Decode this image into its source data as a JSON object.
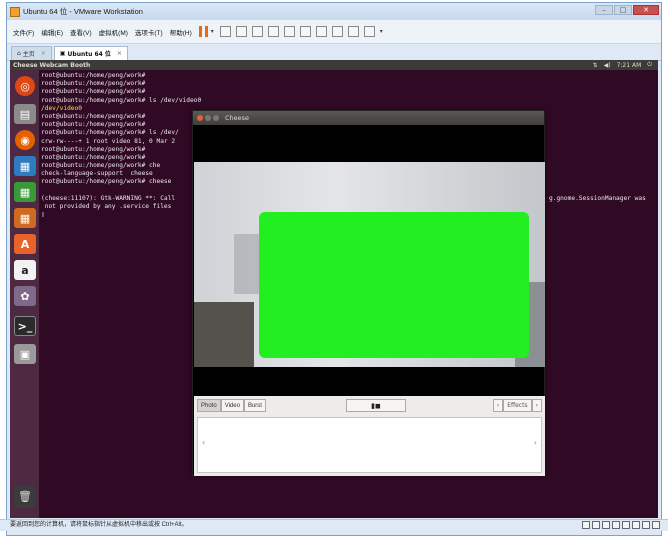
{
  "vmware": {
    "title": "Ubuntu 64 位 - VMware Workstation",
    "menus": [
      "文件(F)",
      "编辑(E)",
      "查看(V)",
      "虚拟机(M)",
      "选项卡(T)",
      "帮助(H)"
    ],
    "tabs": [
      {
        "label": "主页",
        "close": "×"
      },
      {
        "label": "Ubuntu 64 位",
        "close": "×"
      }
    ],
    "status_text": "要返回到您的计算机，请将鼠标指针从虚拟机中移出或按 Ctrl+Alt。",
    "window_controls": {
      "minimize": "–",
      "maximize": "□",
      "close": "✕"
    }
  },
  "ubuntu": {
    "topbar_title": "Cheese Webcam Booth",
    "tray": {
      "network": "⇅",
      "volume": "◀)",
      "time": "7:21 AM",
      "power": "⏻"
    }
  },
  "terminal": {
    "lines": [
      "root@ubuntu:/home/peng/work#",
      "root@ubuntu:/home/peng/work#",
      "root@ubuntu:/home/peng/work#",
      "root@ubuntu:/home/peng/work# ls /dev/video0",
      "/dev/video0",
      "root@ubuntu:/home/peng/work#",
      "root@ubuntu:/home/peng/work#",
      "root@ubuntu:/home/peng/work# ls /dev/",
      "crw-rw----+ 1 root video 81, 0 Mar 2",
      "root@ubuntu:/home/peng/work#",
      "root@ubuntu:/home/peng/work#",
      "root@ubuntu:/home/peng/work# che",
      "check-language-support  cheese",
      "root@ubuntu:/home/peng/work# cheese",
      "",
      "(cheese:11107): Gtk-WARNING **: Call",
      " not provided by any .service files",
      "▯"
    ],
    "right_fragment": "g.gnome.SessionManager was"
  },
  "cheese": {
    "title": "Cheese",
    "modes": [
      "Photo",
      "Video",
      "Burst"
    ],
    "active_mode": "Photo",
    "shutter_icon": "▮◼",
    "effects_label": "Effects",
    "prev_arrow": "‹",
    "next_arrow": "›",
    "thumb_prev": "‹",
    "thumb_next": "›"
  },
  "colors": {
    "ubuntu_bg": "#300a24",
    "overlay_green": "#22ee22",
    "launcher": "#4d2a42"
  }
}
